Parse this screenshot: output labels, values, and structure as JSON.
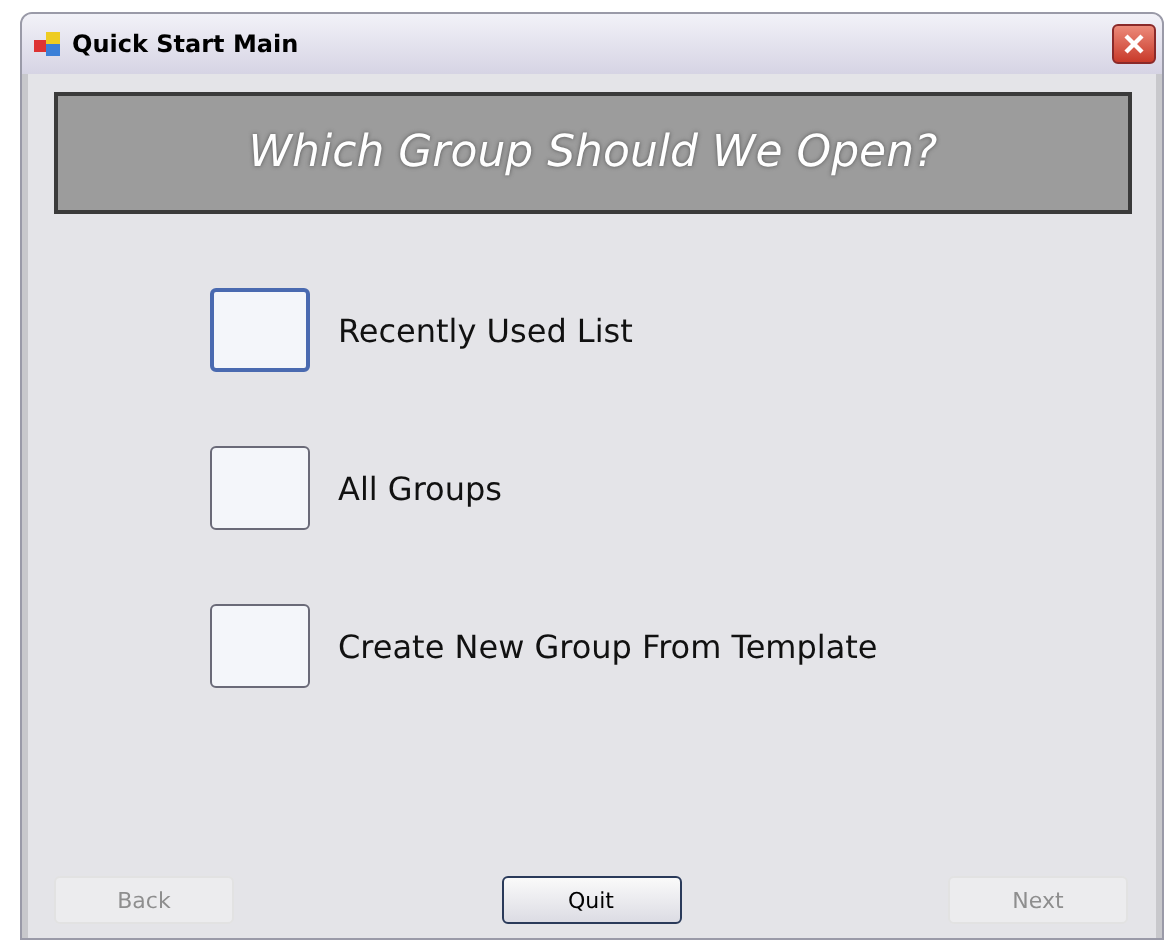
{
  "window": {
    "title": "Quick Start Main"
  },
  "banner": {
    "text": "Which Group Should We Open?"
  },
  "options": [
    {
      "label": "Recently Used List",
      "focused": true
    },
    {
      "label": "All Groups",
      "focused": false
    },
    {
      "label": "Create New Group From Template",
      "focused": false
    }
  ],
  "buttons": [
    {
      "label": "Back",
      "disabled": true
    },
    {
      "label": "Quit",
      "disabled": false
    },
    {
      "label": "Next",
      "disabled": true
    }
  ]
}
